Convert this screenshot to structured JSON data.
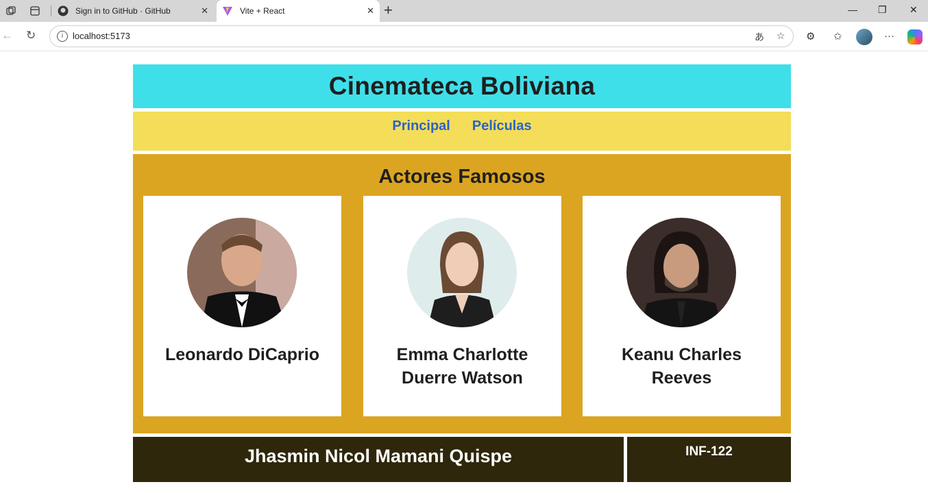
{
  "browser": {
    "tabs": [
      {
        "title": "Sign in to GitHub · GitHub",
        "icon": "github-icon",
        "active": false
      },
      {
        "title": "Vite + React",
        "icon": "vite-icon",
        "active": true
      }
    ],
    "url": "localhost:5173"
  },
  "page": {
    "site_title": "Cinemateca Boliviana",
    "nav": [
      {
        "label": "Principal"
      },
      {
        "label": "Películas"
      }
    ],
    "section_title": "Actores Famosos",
    "actors": [
      {
        "name": "Leonardo DiCaprio",
        "photo": "leonardo-dicaprio-photo"
      },
      {
        "name": "Emma Charlotte Duerre Watson",
        "photo": "emma-watson-photo"
      },
      {
        "name": "Keanu Charles Reeves",
        "photo": "keanu-reeves-photo"
      }
    ],
    "footer": {
      "author": "Jhasmin Nicol Mamani Quispe",
      "course": "INF-122"
    }
  },
  "colors": {
    "header_bg": "#3fdfe9",
    "nav_bg": "#f4dd59",
    "nav_link": "#2a63c8",
    "main_bg": "#dba521",
    "footer_bg": "#2e270b"
  }
}
